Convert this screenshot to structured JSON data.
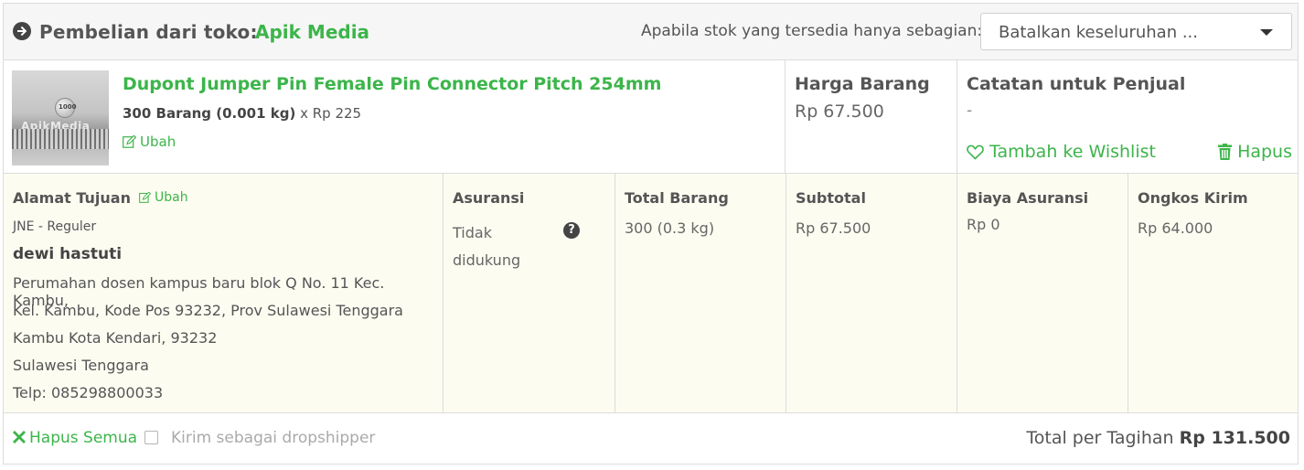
{
  "header": {
    "store_prefix": "Pembelian dari toko:",
    "store_name": "Apik Media",
    "stock_label": "Apabila stok yang tersedia hanya sebagian:",
    "stock_select_value": "Batalkan keseluruhan ..."
  },
  "product": {
    "title": "Dupont Jumper Pin Female Pin Connector Pitch 254mm",
    "qty_bold": "300 Barang (0.001 kg)",
    "qty_rest": " x Rp 225",
    "edit_label": "Ubah",
    "image_watermark": "ApikMedia",
    "image_coin": "1000"
  },
  "price": {
    "label": "Harga Barang",
    "value": "Rp 67.500"
  },
  "notes": {
    "label": "Catatan untuk Penjual",
    "value": "-",
    "wishlist_label": "Tambah ke Wishlist",
    "delete_label": "Hapus"
  },
  "shipping": {
    "address_label": "Alamat Tujuan",
    "edit_label": "Ubah",
    "courier": "JNE - Reguler",
    "recipient": "dewi hastuti",
    "address_lines": [
      "Perumahan dosen kampus baru blok Q No. 11 Kec. Kambu,",
      "Kel. Kambu, Kode Pos 93232, Prov Sulawesi Tenggara",
      "Kambu Kota Kendari, 93232",
      "Sulawesi Tenggara",
      "Telp: 085298800033"
    ],
    "insurance_label": "Asuransi",
    "insurance_value_1": "Tidak",
    "insurance_value_2": "didukung",
    "total_items_label": "Total Barang",
    "total_items_value": "300 (0.3 kg)",
    "subtotal_label": "Subtotal",
    "subtotal_value": "Rp 67.500",
    "insurance_fee_label": "Biaya Asuransi",
    "insurance_fee_value": "Rp 0",
    "shipping_fee_label": "Ongkos Kirim",
    "shipping_fee_value": "Rp 64.000"
  },
  "footer": {
    "delete_all_label": "Hapus Semua",
    "dropshipper_label": "Kirim sebagai dropshipper",
    "dropshipper_checked": false,
    "total_label": "Total per Tagihan",
    "total_value": "Rp 131.500"
  },
  "colors": {
    "accent": "#3cb54a",
    "header_bg": "#f6f6f6",
    "detail_bg": "#fdfcf1",
    "border": "#dcdcdc"
  }
}
